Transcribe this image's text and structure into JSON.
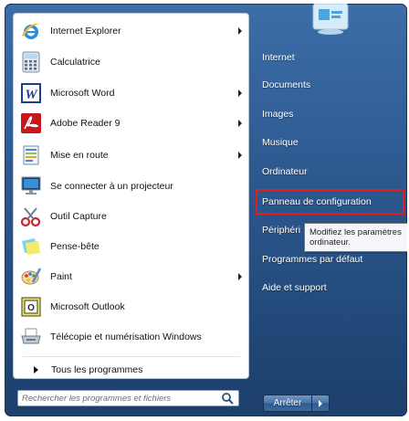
{
  "programs": [
    {
      "label": "Internet Explorer",
      "icon": "internet-explorer-icon",
      "has_submenu": true
    },
    {
      "label": "Calculatrice",
      "icon": "calculator-icon",
      "has_submenu": false
    },
    {
      "label": "Microsoft Word",
      "icon": "word-icon",
      "has_submenu": true
    },
    {
      "label": "Adobe Reader 9",
      "icon": "adobe-reader-icon",
      "has_submenu": true
    },
    {
      "label": "Mise en route",
      "icon": "getting-started-icon",
      "has_submenu": true
    },
    {
      "label": "Se connecter à un projecteur",
      "icon": "projector-icon",
      "has_submenu": false
    },
    {
      "label": "Outil Capture",
      "icon": "snipping-tool-icon",
      "has_submenu": false
    },
    {
      "label": "Pense-bête",
      "icon": "sticky-notes-icon",
      "has_submenu": false
    },
    {
      "label": "Paint",
      "icon": "paint-icon",
      "has_submenu": true
    },
    {
      "label": "Microsoft Outlook",
      "icon": "outlook-icon",
      "has_submenu": false
    },
    {
      "label": "Télécopie et numérisation Windows",
      "icon": "fax-scan-icon",
      "has_submenu": false
    }
  ],
  "all_programs_label": "Tous les programmes",
  "search": {
    "placeholder": "Rechercher les programmes et fichiers",
    "value": ""
  },
  "right_items": [
    {
      "label": "Internet"
    },
    {
      "label": "Documents"
    },
    {
      "label": "Images"
    },
    {
      "label": "Musique"
    },
    {
      "label": "Ordinateur"
    },
    {
      "label": "Panneau de configuration"
    },
    {
      "label": "Périphéri"
    },
    {
      "label": "Programmes par défaut"
    },
    {
      "label": "Aide et support"
    }
  ],
  "tooltip": {
    "line1": "Modifiez les paramètres",
    "line2": "ordinateur."
  },
  "shutdown_label": "Arrêter",
  "colors": {
    "highlight": "#e51b20",
    "menu_blue": "#2f5c93"
  }
}
